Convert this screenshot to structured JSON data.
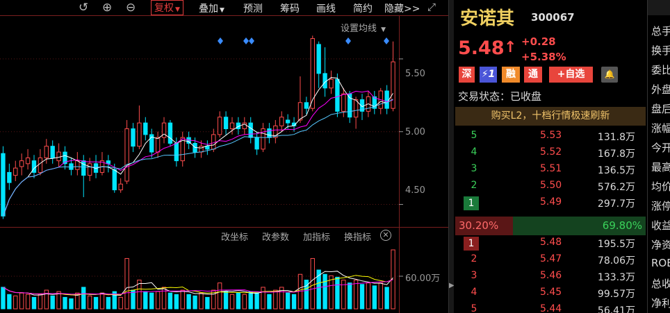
{
  "toolbar": {
    "undo_icon": "undo-icon",
    "zoom_in_icon": "zoom-in-icon",
    "zoom_out_icon": "zoom-out-icon",
    "fuquan_label": "复权",
    "overlay_label": "叠加",
    "forecast_label": "预测",
    "chips_label": "筹码",
    "drawline_label": "画线",
    "compact_label": "简约",
    "hide_label": "隐藏>>",
    "fullscreen_icon": "fullscreen-icon",
    "active_color": "#e03c3c"
  },
  "chart": {
    "ma_setting_label": "设置均线",
    "price_ticks": [
      "5.50",
      "5.00",
      "4.50"
    ],
    "volume_tools": [
      "改坐标",
      "改参数",
      "加指标",
      "换指标"
    ],
    "volume_close_symbol": "⊗",
    "volume_tick": "60.00万",
    "up_color": "#ff4d4d",
    "down_color": "#00e5ff",
    "ma_colors": [
      "#ffffff",
      "#ff00ff",
      "#57c8ff"
    ]
  },
  "chart_data": {
    "type": "candlestick",
    "yticks": [
      5.5,
      5.0,
      4.5
    ],
    "ylim": [
      4.35,
      5.8
    ],
    "candles": [
      [
        4.85,
        4.42,
        4.9,
        4.4
      ],
      [
        4.72,
        4.65,
        4.78,
        4.6
      ],
      [
        4.7,
        4.75,
        4.8,
        4.66
      ],
      [
        4.76,
        4.8,
        4.85,
        4.7
      ],
      [
        4.78,
        4.82,
        4.88,
        4.74
      ],
      [
        4.8,
        4.72,
        4.84,
        4.68
      ],
      [
        4.72,
        4.82,
        4.88,
        4.7
      ],
      [
        4.82,
        4.9,
        4.95,
        4.78
      ],
      [
        4.9,
        4.82,
        4.94,
        4.78
      ],
      [
        4.8,
        4.86,
        4.92,
        4.76
      ],
      [
        4.86,
        4.78,
        4.9,
        4.74
      ],
      [
        4.78,
        4.74,
        4.82,
        4.7
      ],
      [
        4.74,
        4.8,
        4.86,
        4.7
      ],
      [
        4.8,
        4.7,
        4.84,
        4.55
      ],
      [
        4.7,
        4.78,
        4.82,
        4.66
      ],
      [
        4.78,
        4.72,
        4.84,
        4.68
      ],
      [
        4.72,
        4.8,
        4.86,
        4.7
      ],
      [
        4.8,
        4.78,
        4.84,
        4.72
      ],
      [
        4.74,
        4.6,
        4.78,
        4.58
      ],
      [
        4.6,
        4.64,
        4.68,
        4.58
      ],
      [
        4.66,
        5.02,
        5.08,
        4.64
      ],
      [
        5.02,
        4.9,
        5.06,
        4.86
      ],
      [
        4.9,
        5.06,
        5.18,
        4.88
      ],
      [
        5.06,
        4.98,
        5.1,
        4.94
      ],
      [
        4.98,
        4.86,
        5.02,
        4.82
      ],
      [
        4.86,
        4.96,
        5.0,
        4.82
      ],
      [
        4.96,
        5.06,
        5.1,
        4.92
      ],
      [
        5.06,
        4.92,
        5.08,
        4.9
      ],
      [
        4.92,
        4.8,
        4.96,
        4.76
      ],
      [
        4.8,
        4.96,
        5.0,
        4.76
      ],
      [
        4.96,
        4.92,
        5.0,
        4.88
      ],
      [
        4.92,
        4.86,
        4.96,
        4.82
      ],
      [
        4.86,
        4.9,
        4.94,
        4.82
      ],
      [
        4.9,
        4.88,
        4.94,
        4.84
      ],
      [
        4.88,
        4.98,
        5.02,
        4.86
      ],
      [
        4.98,
        5.1,
        5.14,
        4.96
      ],
      [
        5.1,
        5.02,
        5.14,
        4.98
      ],
      [
        5.02,
        5.06,
        5.1,
        4.98
      ],
      [
        5.06,
        5.02,
        5.1,
        4.98
      ],
      [
        5.02,
        5.06,
        5.1,
        4.98
      ],
      [
        5.06,
        4.96,
        5.1,
        4.92
      ],
      [
        4.96,
        4.88,
        5.0,
        4.84
      ],
      [
        4.88,
        5.02,
        5.06,
        4.86
      ],
      [
        5.02,
        4.96,
        5.06,
        4.92
      ],
      [
        4.96,
        5.04,
        5.08,
        4.92
      ],
      [
        5.04,
        5.1,
        5.14,
        5.0
      ],
      [
        5.08,
        5.06,
        5.12,
        5.02
      ],
      [
        5.06,
        5.04,
        5.1,
        5.0
      ],
      [
        5.08,
        5.2,
        5.38,
        5.06
      ],
      [
        5.2,
        5.16,
        5.24,
        5.12
      ],
      [
        5.16,
        5.64,
        5.66,
        5.14
      ],
      [
        5.6,
        5.4,
        5.62,
        5.3
      ],
      [
        5.4,
        5.3,
        5.58,
        5.24
      ],
      [
        5.3,
        5.36,
        5.42,
        5.26
      ],
      [
        5.36,
        5.14,
        5.4,
        5.1
      ],
      [
        5.14,
        5.26,
        5.3,
        5.1
      ],
      [
        5.26,
        5.1,
        5.28,
        5.06
      ],
      [
        5.1,
        5.22,
        5.24,
        5.02
      ],
      [
        5.22,
        5.14,
        5.26,
        5.08
      ],
      [
        5.14,
        5.24,
        5.28,
        5.1
      ],
      [
        5.24,
        5.16,
        5.28,
        5.12
      ],
      [
        5.16,
        5.28,
        5.3,
        5.12
      ],
      [
        5.28,
        5.16,
        5.32,
        5.12
      ],
      [
        5.16,
        5.48,
        5.62,
        5.14
      ]
    ],
    "volumes": [
      30,
      20,
      18,
      22,
      20,
      16,
      20,
      26,
      18,
      24,
      16,
      14,
      22,
      30,
      18,
      16,
      22,
      16,
      24,
      16,
      70,
      26,
      40,
      24,
      22,
      24,
      30,
      22,
      20,
      26,
      20,
      18,
      22,
      16,
      26,
      36,
      24,
      20,
      22,
      20,
      24,
      22,
      30,
      20,
      26,
      30,
      22,
      20,
      48,
      40,
      70,
      54,
      48,
      46,
      44,
      40,
      36,
      40,
      34,
      36,
      32,
      36,
      30,
      82
    ],
    "ma_lines": [
      "MA5",
      "MA10",
      "MA20"
    ]
  },
  "quote": {
    "name": "安诺其",
    "code": "300067",
    "price": "5.48",
    "arrow": "↑",
    "change": "+0.28",
    "change_pct": "+5.38%",
    "badges": [
      "深",
      "⚡1",
      "融",
      "通",
      "+自选",
      "🔔"
    ],
    "trade_status": "交易状态：已收盘",
    "l2_banner": "购买L2，十档行情极速刷新",
    "sell": [
      {
        "idx": "5",
        "price": "5.53",
        "vol": "131.8万"
      },
      {
        "idx": "4",
        "price": "5.52",
        "vol": "167.8万"
      },
      {
        "idx": "3",
        "price": "5.51",
        "vol": "136.5万"
      },
      {
        "idx": "2",
        "price": "5.50",
        "vol": "576.2万"
      },
      {
        "idx": "1",
        "price": "5.49",
        "vol": "297.7万"
      }
    ],
    "buy_ratio": "30.20%",
    "sell_ratio": "69.80%",
    "buy_ratio_value": 30.2,
    "buy": [
      {
        "idx": "1",
        "price": "5.48",
        "vol": "195.5万"
      },
      {
        "idx": "2",
        "price": "5.47",
        "vol": "78.06万"
      },
      {
        "idx": "3",
        "price": "5.46",
        "vol": "133.3万"
      },
      {
        "idx": "4",
        "price": "5.45",
        "vol": "99.57万"
      },
      {
        "idx": "5",
        "price": "5.44",
        "vol": "56.41万"
      }
    ]
  },
  "info_column": [
    "总手",
    "换手",
    "委比",
    "外盘",
    "盘后",
    "涨幅",
    "今开",
    "最高",
    "均价",
    "涨停",
    "收益",
    "净资",
    "ROE",
    "总收",
    "净利"
  ]
}
